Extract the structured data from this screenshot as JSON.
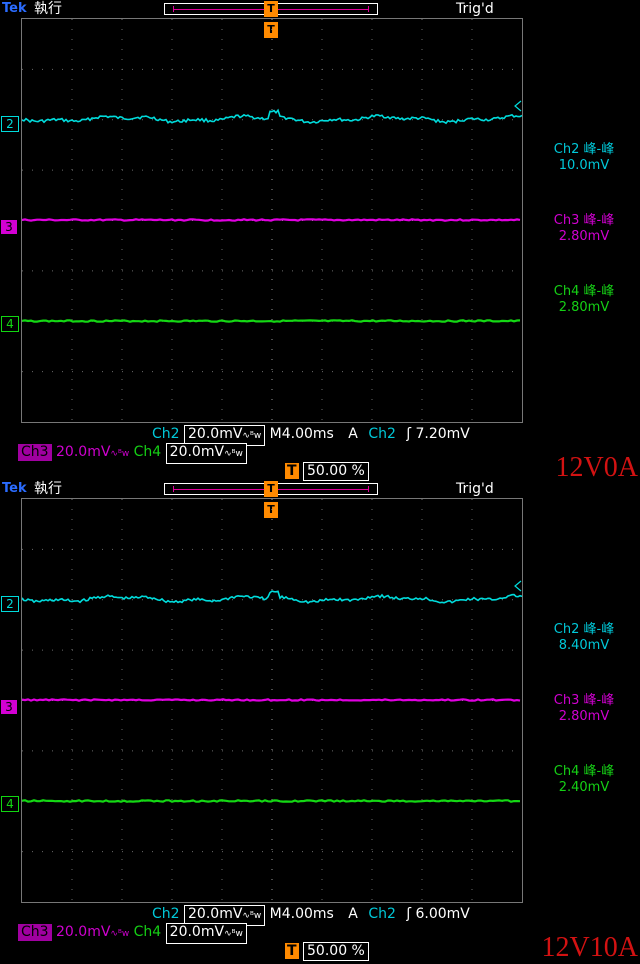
{
  "screens": [
    {
      "brand": "Tek",
      "run_state": "執行",
      "trigger_state": "Trig'd",
      "trigger_marker": "T",
      "channel_markers": {
        "ch2": "2",
        "ch3": "3",
        "ch4": "4"
      },
      "measurements": [
        {
          "label": "Ch2 峰-峰",
          "value": "10.0mV"
        },
        {
          "label": "Ch3 峰-峰",
          "value": "2.80mV"
        },
        {
          "label": "Ch4 峰-峰",
          "value": "2.80mV"
        }
      ],
      "bottom": {
        "ch2_name": "Ch2",
        "ch2_scale": "20.0mV",
        "ch2_icon": "∿ᴮw",
        "timebase": "M4.00ms",
        "trig_mode": "A",
        "trig_source": "Ch2",
        "trig_slope": "ʃ",
        "trig_level": "7.20mV",
        "ch3_name": "Ch3",
        "ch3_scale": "20.0mV",
        "ch3_icon": "∿ᴮw",
        "ch4_name": "Ch4",
        "ch4_scale": "20.0mV",
        "ch4_icon": "∿ᴮw",
        "trig_pos_icon": "T",
        "trig_pos": "50.00 %"
      },
      "caption": "12V0A"
    },
    {
      "brand": "Tek",
      "run_state": "執行",
      "trigger_state": "Trig'd",
      "trigger_marker": "T",
      "channel_markers": {
        "ch2": "2",
        "ch3": "3",
        "ch4": "4"
      },
      "measurements": [
        {
          "label": "Ch2 峰-峰",
          "value": "8.40mV"
        },
        {
          "label": "Ch3 峰-峰",
          "value": "2.80mV"
        },
        {
          "label": "Ch4 峰-峰",
          "value": "2.40mV"
        }
      ],
      "bottom": {
        "ch2_name": "Ch2",
        "ch2_scale": "20.0mV",
        "ch2_icon": "∿ᴮw",
        "timebase": "M4.00ms",
        "trig_mode": "A",
        "trig_source": "Ch2",
        "trig_slope": "ʃ",
        "trig_level": "6.00mV",
        "ch3_name": "Ch3",
        "ch3_scale": "20.0mV",
        "ch3_icon": "∿ᴮw",
        "ch4_name": "Ch4",
        "ch4_scale": "20.0mV",
        "ch4_icon": "∿ᴮw",
        "trig_pos_icon": "T",
        "trig_pos": "50.00 %"
      },
      "caption": "12V10A"
    }
  ],
  "colors": {
    "ch2": "#00dcdc",
    "ch3": "#e000e0",
    "ch4": "#14d814",
    "trigger": "#ff8a00"
  }
}
